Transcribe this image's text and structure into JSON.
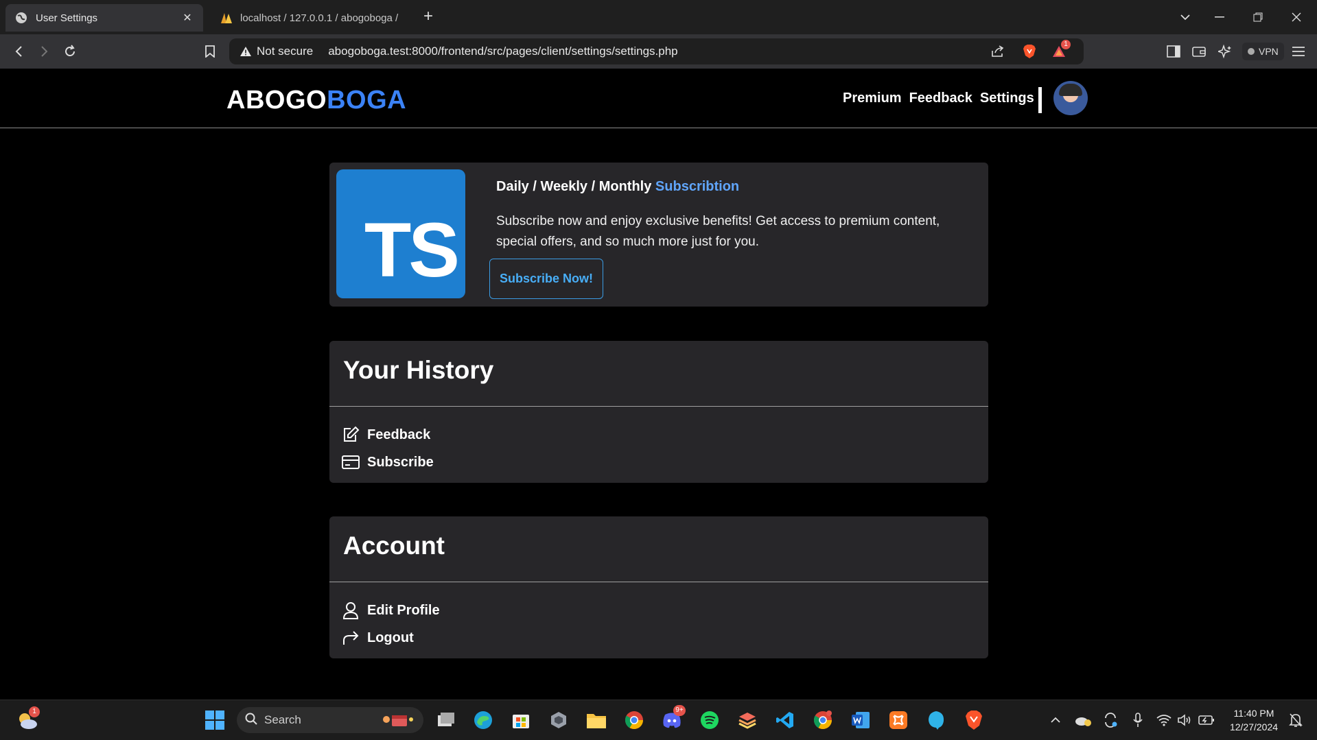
{
  "browser": {
    "tabs": [
      {
        "title": "User Settings",
        "active": true
      },
      {
        "title": "localhost / 127.0.0.1 / abogoboga /",
        "active": false
      }
    ],
    "new_tab_label": "+",
    "close_label": "✕",
    "security_label": "Not secure",
    "url": "abogoboga.test:8000/frontend/src/pages/client/settings/settings.php",
    "vpn_label": "VPN",
    "notification_count": "1"
  },
  "site": {
    "logo_part1": "ABOGO",
    "logo_part2": "BOGA",
    "nav": [
      "Premium",
      "Feedback",
      "Settings"
    ]
  },
  "subscription": {
    "logo_text": "TS",
    "title_plain": "Daily / Weekly / Monthly",
    "title_accent": "Subscribtion",
    "description": "Subscribe now and enjoy exclusive benefits! Get access to premium content, special offers, and so much more just for you.",
    "button": "Subscribe Now!"
  },
  "history": {
    "title": "Your History",
    "items": [
      "Feedback",
      "Subscribe"
    ]
  },
  "account": {
    "title": "Account",
    "items": [
      "Edit Profile",
      "Logout"
    ]
  },
  "taskbar": {
    "search_placeholder": "Search",
    "time": "11:40 PM",
    "date": "12/27/2024",
    "weather_badge": "1",
    "discord_badge": "9+"
  },
  "colors": {
    "accent": "#3b82f6",
    "ts_blue": "#1e7fd0",
    "card_bg": "#272629"
  }
}
